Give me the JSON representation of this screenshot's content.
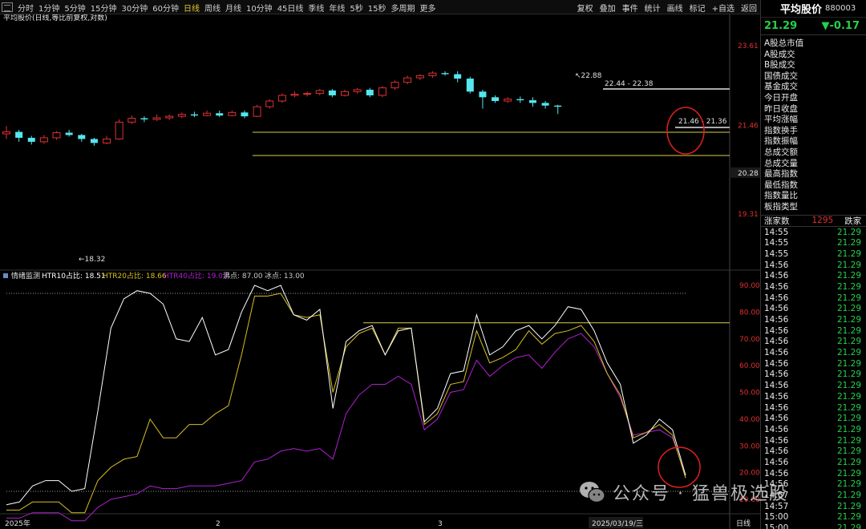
{
  "topbar": {
    "tabs": [
      "分时",
      "1分钟",
      "5分钟",
      "15分钟",
      "30分钟",
      "60分钟",
      "日线",
      "周线",
      "月线",
      "10分钟",
      "45日线",
      "季线",
      "年线",
      "5秒",
      "15秒",
      "多周期",
      "更多"
    ],
    "active_tab": "日线",
    "tools": [
      "复权",
      "叠加",
      "事件",
      "统计",
      "画线",
      "标记",
      "+自选",
      "返回"
    ]
  },
  "main_chart": {
    "title": "平均股价(日线,等比前复权,对数)",
    "price_labels": [
      "23.61",
      "21.46",
      "20.28",
      "19.31"
    ],
    "annotations": [
      "22.88",
      "22.44 - 22.38",
      "21.46 - 21.36",
      "18.32"
    ]
  },
  "indicator": {
    "name": "情绪监测",
    "htr10_label": "HTR10占比: 18.51",
    "htr20_label": "HTR20占比: 18.66",
    "htr40_label": "HTR40占比: 19.01",
    "boil_label": "沸点: 87.00",
    "ice_label": "冰点: 13.00",
    "axis_labels": [
      "90.00",
      "80.00",
      "70.00",
      "60.00",
      "50.00",
      "40.00",
      "30.00",
      "20.00",
      "10.00"
    ]
  },
  "xaxis": {
    "labels": [
      "2025年",
      "2",
      "3",
      "2025/03/19/三"
    ],
    "period": "日线"
  },
  "right_panel": {
    "title": "平均股价",
    "code": "880003",
    "price": "21.29",
    "change": "▼-0.17",
    "fields": [
      "A股总市值",
      "A股成交",
      "B股成交",
      "国债成交",
      "基金成交",
      "今日开盘",
      "昨日收盘",
      "平均涨幅",
      "指数换手",
      "指数振幅",
      "总成交额",
      "总成交量",
      "最高指数",
      "最低指数",
      "指数量比",
      "板指类型"
    ],
    "stat_label": "涨家数",
    "stat_value": "1295",
    "stat_label2": "跌家",
    "ticks": [
      {
        "time": "14:55",
        "price": "21.29"
      },
      {
        "time": "14:55",
        "price": "21.29"
      },
      {
        "time": "14:55",
        "price": "21.29"
      },
      {
        "time": "14:56",
        "price": "21.29"
      },
      {
        "time": "14:56",
        "price": "21.29"
      },
      {
        "time": "14:56",
        "price": "21.29"
      },
      {
        "time": "14:56",
        "price": "21.29"
      },
      {
        "time": "14:56",
        "price": "21.29"
      },
      {
        "time": "14:56",
        "price": "21.29"
      },
      {
        "time": "14:56",
        "price": "21.29"
      },
      {
        "time": "14:56",
        "price": "21.29"
      },
      {
        "time": "14:56",
        "price": "21.29"
      },
      {
        "time": "14:56",
        "price": "21.29"
      },
      {
        "time": "14:56",
        "price": "21.29"
      },
      {
        "time": "14:56",
        "price": "21.29"
      },
      {
        "time": "14:56",
        "price": "21.29"
      },
      {
        "time": "14:56",
        "price": "21.29"
      },
      {
        "time": "14:56",
        "price": "21.29"
      },
      {
        "time": "14:56",
        "price": "21.29"
      },
      {
        "time": "14:56",
        "price": "21.29"
      },
      {
        "time": "14:56",
        "price": "21.29"
      },
      {
        "time": "14:56",
        "price": "21.29"
      },
      {
        "time": "14:56",
        "price": "21.29"
      },
      {
        "time": "14:56",
        "price": "21.29"
      },
      {
        "time": "14:57",
        "price": "21.29"
      },
      {
        "time": "14:57",
        "price": "21.29"
      },
      {
        "time": "15:00",
        "price": "21.29"
      },
      {
        "time": "15:00",
        "price": "21.29"
      },
      {
        "time": "15:00",
        "price": "21.29"
      }
    ]
  },
  "watermark": "公众号 · 猛兽极选股",
  "colors": {
    "up": "#e03030",
    "down": "#55e6f0",
    "htr10": "#ffffff",
    "htr20": "#d8c020",
    "htr40": "#b020d0",
    "level": "#d8d040",
    "highlight": "#e02020"
  },
  "chart_data": {
    "type": "candlestick",
    "candles": [
      [
        21.25,
        21.3,
        21.45,
        21.12
      ],
      [
        21.3,
        21.15,
        21.35,
        21.05
      ],
      [
        21.15,
        21.05,
        21.2,
        20.98
      ],
      [
        21.05,
        21.15,
        21.22,
        21.0
      ],
      [
        21.15,
        21.28,
        21.32,
        21.1
      ],
      [
        21.28,
        21.22,
        21.35,
        21.18
      ],
      [
        21.22,
        21.12,
        21.25,
        21.05
      ],
      [
        21.12,
        21.02,
        21.15,
        20.95
      ],
      [
        21.02,
        21.12,
        21.2,
        20.99
      ],
      [
        21.12,
        21.55,
        21.62,
        21.1
      ],
      [
        21.55,
        21.65,
        21.72,
        21.5
      ],
      [
        21.65,
        21.62,
        21.7,
        21.55
      ],
      [
        21.62,
        21.66,
        21.75,
        21.58
      ],
      [
        21.66,
        21.7,
        21.75,
        21.6
      ],
      [
        21.7,
        21.75,
        21.8,
        21.65
      ],
      [
        21.75,
        21.72,
        21.82,
        21.68
      ],
      [
        21.72,
        21.78,
        21.85,
        21.7
      ],
      [
        21.78,
        21.72,
        21.85,
        21.68
      ],
      [
        21.72,
        21.8,
        21.85,
        21.7
      ],
      [
        21.8,
        21.7,
        21.85,
        21.65
      ],
      [
        21.7,
        21.95,
        22.0,
        21.68
      ],
      [
        21.95,
        22.1,
        22.15,
        21.9
      ],
      [
        22.1,
        22.25,
        22.3,
        22.05
      ],
      [
        22.25,
        22.28,
        22.35,
        22.2
      ],
      [
        22.28,
        22.3,
        22.35,
        22.22
      ],
      [
        22.3,
        22.38,
        22.42,
        22.25
      ],
      [
        22.38,
        22.25,
        22.42,
        22.2
      ],
      [
        22.25,
        22.35,
        22.4,
        22.22
      ],
      [
        22.35,
        22.4,
        22.45,
        22.3
      ],
      [
        22.4,
        22.25,
        22.45,
        22.2
      ],
      [
        22.25,
        22.45,
        22.5,
        22.2
      ],
      [
        22.45,
        22.6,
        22.65,
        22.4
      ],
      [
        22.6,
        22.72,
        22.78,
        22.55
      ],
      [
        22.72,
        22.78,
        22.82,
        22.66
      ],
      [
        22.78,
        22.85,
        22.9,
        22.72
      ],
      [
        22.85,
        22.82,
        22.9,
        22.78
      ],
      [
        22.82,
        22.7,
        22.9,
        22.6
      ],
      [
        22.7,
        22.35,
        22.75,
        22.3
      ],
      [
        22.35,
        22.2,
        22.4,
        21.9
      ],
      [
        22.2,
        22.1,
        22.25,
        22.05
      ],
      [
        22.1,
        22.15,
        22.2,
        22.05
      ],
      [
        22.15,
        22.12,
        22.22,
        22.05
      ],
      [
        22.12,
        22.05,
        22.2,
        21.95
      ],
      [
        22.05,
        21.98,
        22.1,
        21.9
      ],
      [
        21.98,
        21.95,
        22.0,
        21.76
      ]
    ],
    "htr10": [
      8,
      9,
      15,
      17,
      17,
      13,
      14,
      43,
      74,
      85,
      88,
      87,
      83,
      70,
      69,
      78,
      64,
      66,
      80,
      90,
      88,
      90,
      79,
      77,
      81,
      44,
      69,
      73,
      75,
      64,
      73,
      74,
      39,
      44,
      57,
      58,
      79,
      64,
      67,
      73,
      75,
      70,
      75,
      82,
      81,
      73,
      61,
      53,
      31,
      34,
      40,
      36,
      19
    ],
    "htr20": [
      6,
      6,
      9,
      9,
      9,
      5,
      5,
      17,
      22,
      25,
      26,
      40,
      33,
      33,
      38,
      38,
      42,
      45,
      64,
      86,
      86,
      87,
      79,
      78,
      79,
      50,
      67,
      72,
      74,
      64,
      74,
      74,
      38,
      42,
      53,
      54,
      73,
      61,
      63,
      66,
      73,
      68,
      72,
      73,
      75,
      69,
      57,
      49,
      33,
      35,
      38,
      34,
      18
    ],
    "htr40": [
      3,
      3,
      5,
      5,
      5,
      2,
      2,
      7,
      10,
      11,
      12,
      15,
      14,
      14,
      15,
      15,
      15,
      16,
      17,
      24,
      25,
      28,
      29,
      28,
      29,
      25,
      42,
      49,
      53,
      53,
      56,
      53,
      36,
      40,
      50,
      51,
      62,
      56,
      60,
      63,
      64,
      59,
      65,
      70,
      72,
      67,
      57,
      48,
      34,
      35,
      36,
      33,
      19
    ]
  }
}
